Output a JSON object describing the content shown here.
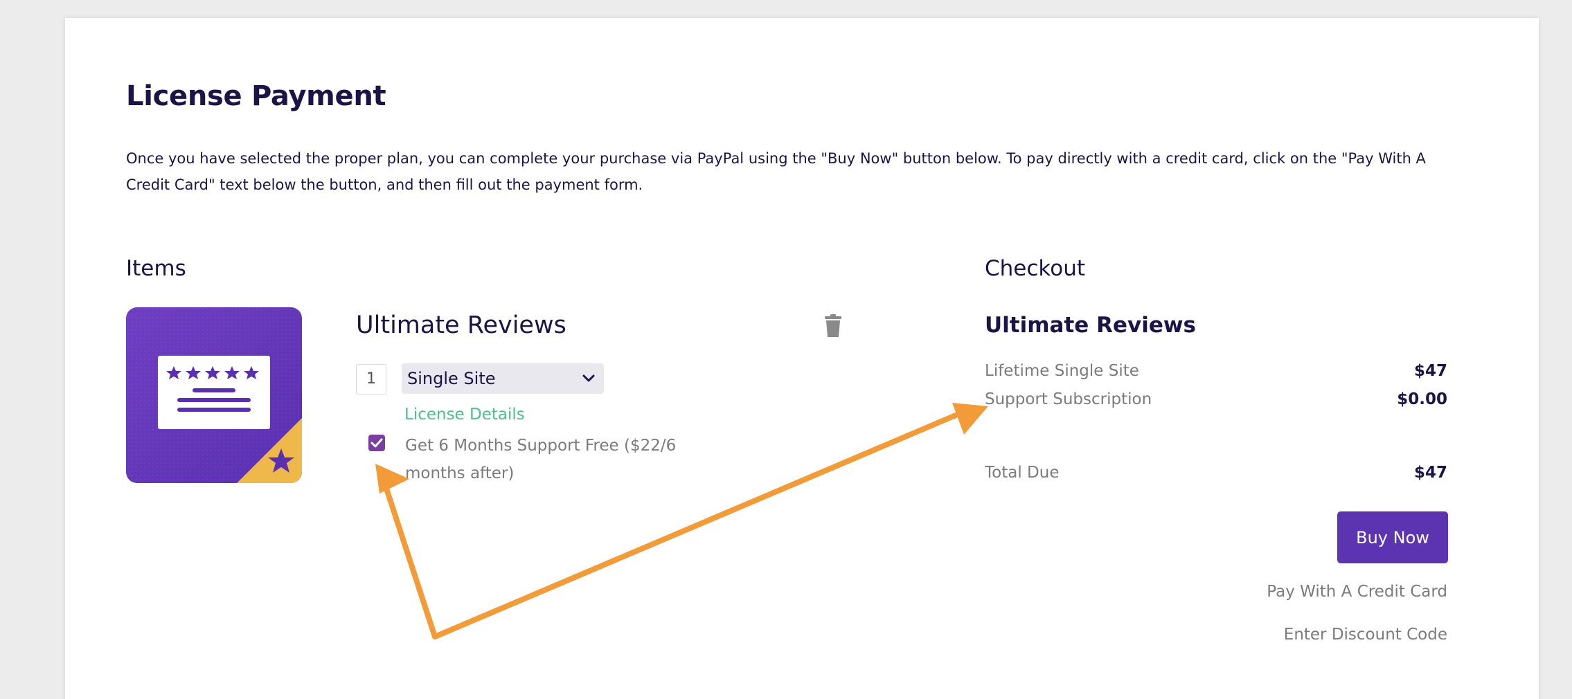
{
  "page": {
    "title": "License Payment",
    "intro": "Once you have selected the proper plan, you can complete your purchase via PayPal using the \"Buy Now\" button below. To pay directly with a credit card, click on the \"Pay With A Credit Card\" text below the button, and then fill out the payment form."
  },
  "items": {
    "heading": "Items",
    "product": {
      "name": "Ultimate Reviews",
      "image_icon": "reviews-card-icon",
      "quantity": "1",
      "plan_selected": "Single Site",
      "license_details_label": "License Details",
      "support_checkbox_checked": true,
      "support_line1": "Get 6 Months Support Free ($22/6",
      "support_line2": "months after)"
    }
  },
  "checkout": {
    "heading": "Checkout",
    "product_name": "Ultimate Reviews",
    "lines": [
      {
        "label": "Lifetime Single Site",
        "value": "$47"
      },
      {
        "label": "Support Subscription",
        "value": "$0.00"
      }
    ],
    "total_label": "Total Due",
    "total_value": "$47",
    "buy_now_label": "Buy Now",
    "pay_cc_label": "Pay With A Credit Card",
    "discount_label": "Enter Discount Code"
  },
  "colors": {
    "heading": "#1c1446",
    "accent": "#5c33b0",
    "link_green": "#4cbf8c",
    "annotation_arrow": "#f29b38",
    "product_bg": "#6a3bbd",
    "product_corner": "#efb84a"
  }
}
